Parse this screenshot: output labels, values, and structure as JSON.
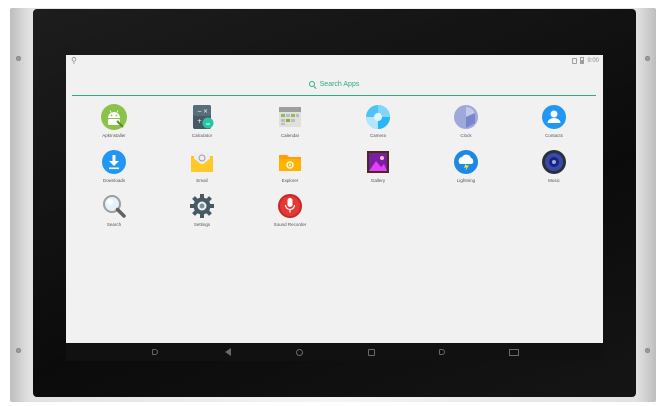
{
  "status_bar": {
    "usb_icon": "usb-icon",
    "sim_icon": "no-sim-icon",
    "battery_icon": "battery-icon",
    "time": "9:00"
  },
  "search": {
    "label": "Search Apps",
    "icon": "search-icon",
    "accent_color": "#2faa83"
  },
  "apps": [
    {
      "label": "ApkInstaller",
      "icon": "android-installer-icon"
    },
    {
      "label": "Calculator",
      "icon": "calculator-icon"
    },
    {
      "label": "Calendar",
      "icon": "calendar-icon"
    },
    {
      "label": "Camera",
      "icon": "camera-icon"
    },
    {
      "label": "Clock",
      "icon": "clock-icon"
    },
    {
      "label": "Contacts",
      "icon": "contacts-icon"
    },
    {
      "label": "Downloads",
      "icon": "downloads-icon"
    },
    {
      "label": "Email",
      "icon": "email-icon"
    },
    {
      "label": "Explorer",
      "icon": "explorer-folder-icon"
    },
    {
      "label": "Gallery",
      "icon": "gallery-icon"
    },
    {
      "label": "Lightning",
      "icon": "lightning-browser-icon"
    },
    {
      "label": "Music",
      "icon": "music-speaker-icon"
    },
    {
      "label": "Search",
      "icon": "magnifier-icon"
    },
    {
      "label": "Settings",
      "icon": "gear-icon"
    },
    {
      "label": "Sound Recorder",
      "icon": "microphone-icon"
    }
  ],
  "nav_bar": {
    "buttons": [
      "volume-down-icon",
      "back-icon",
      "home-icon",
      "recents-icon",
      "volume-up-icon",
      "screenshot-icon"
    ]
  }
}
